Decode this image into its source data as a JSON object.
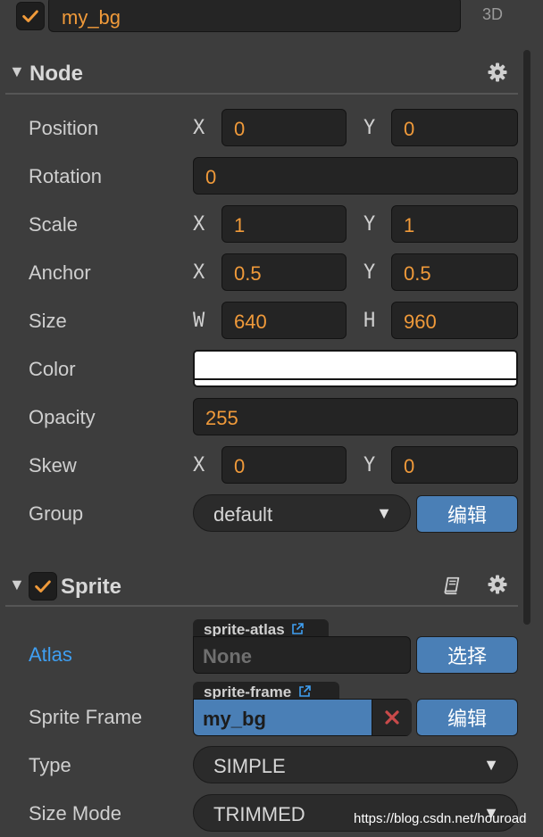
{
  "header": {
    "enabled": true,
    "node_name": "my_bg",
    "mode_label": "3D"
  },
  "node": {
    "title": "Node",
    "position": {
      "label": "Position",
      "x_axis": "X",
      "x": "0",
      "y_axis": "Y",
      "y": "0"
    },
    "rotation": {
      "label": "Rotation",
      "value": "0"
    },
    "scale": {
      "label": "Scale",
      "x_axis": "X",
      "x": "1",
      "y_axis": "Y",
      "y": "1"
    },
    "anchor": {
      "label": "Anchor",
      "x_axis": "X",
      "x": "0.5",
      "y_axis": "Y",
      "y": "0.5"
    },
    "size": {
      "label": "Size",
      "w_axis": "W",
      "w": "640",
      "h_axis": "H",
      "h": "960"
    },
    "color": {
      "label": "Color",
      "value": "#ffffff"
    },
    "opacity": {
      "label": "Opacity",
      "value": "255"
    },
    "skew": {
      "label": "Skew",
      "x_axis": "X",
      "x": "0",
      "y_axis": "Y",
      "y": "0"
    },
    "group": {
      "label": "Group",
      "value": "default",
      "edit_button": "编辑"
    }
  },
  "sprite": {
    "title": "Sprite",
    "enabled": true,
    "atlas": {
      "label": "Atlas",
      "tag": "sprite-atlas",
      "value": "None",
      "select_button": "选择"
    },
    "sprite_frame": {
      "label": "Sprite Frame",
      "tag": "sprite-frame",
      "value": "my_bg",
      "edit_button": "编辑"
    },
    "type": {
      "label": "Type",
      "value": "SIMPLE"
    },
    "size_mode": {
      "label": "Size Mode",
      "value": "TRIMMED"
    }
  },
  "watermark": "https://blog.csdn.net/houroad",
  "icons": {
    "checkbox": "check-icon",
    "gear": "gear-icon",
    "collapse": "triangle-down-icon",
    "docs": "book-icon",
    "external": "external-link-icon",
    "clear": "x-icon"
  },
  "colors": {
    "value_orange": "#f09a3a",
    "accent_blue": "#4a7fb6",
    "link_blue": "#3f9ff2",
    "panel_bg": "#3d3d3d"
  }
}
